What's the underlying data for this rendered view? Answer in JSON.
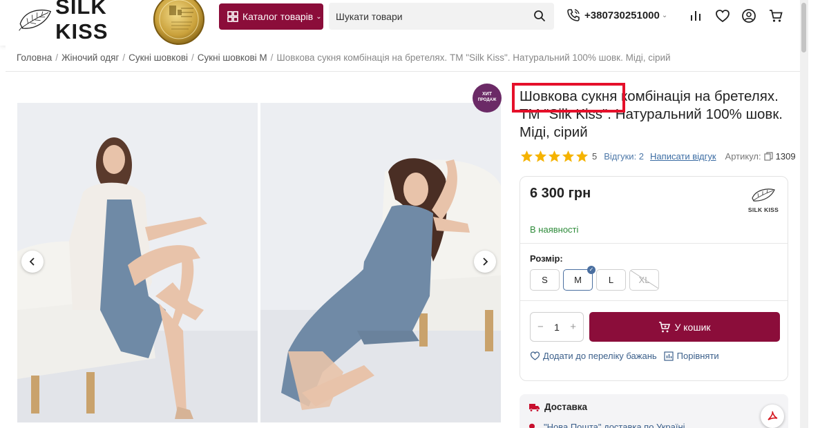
{
  "header": {
    "logo_text": "SILK KISS",
    "catalog_label": "Каталог товарів",
    "search_placeholder": "Шукати товари",
    "phone": "+380730251000"
  },
  "breadcrumb": {
    "items": [
      "Головна",
      "Жіночий одяг",
      "Сукні шовкові",
      "Сукні шовкові М"
    ],
    "current": "Шовкова сукня комбінація на бретелях. ТМ \"Silk Kiss\". Натуральний 100% шовк. Міді, сірий"
  },
  "badge": {
    "line1": "ХИТ",
    "line2": "ПРОДАЖ"
  },
  "product": {
    "title": "Шовкова сукня комбінація на бретелях. ТМ \"Silk Kiss\". Натуральний 100% шовк. Міді, сірий",
    "rating": 5,
    "rating_label": "5",
    "reviews": "Відгуки: 2",
    "write_review": "Написати відгук",
    "article_label": "Артикул:",
    "article": "1309",
    "price": "6 300 грн",
    "brand": "SILK KISS",
    "stock": "В наявності",
    "size_label": "Розмір:",
    "sizes": [
      "S",
      "M",
      "L",
      "XL"
    ],
    "selected_size": "M",
    "unavailable_size": "XL",
    "quantity": "1",
    "cart_label": "У кошик",
    "wishlist_label": "Додати до переліку бажань",
    "compare_label": "Порівняти",
    "delivery_title": "Доставка",
    "delivery_line": "\"Нова Пошта\" доставка по Україні"
  },
  "colors": {
    "accent": "#8b0d3a",
    "badge": "#6b2a66",
    "stock": "#2e8b3a",
    "link": "#3b6ca3",
    "star": "#f5b301",
    "highlight": "#e5102a"
  }
}
